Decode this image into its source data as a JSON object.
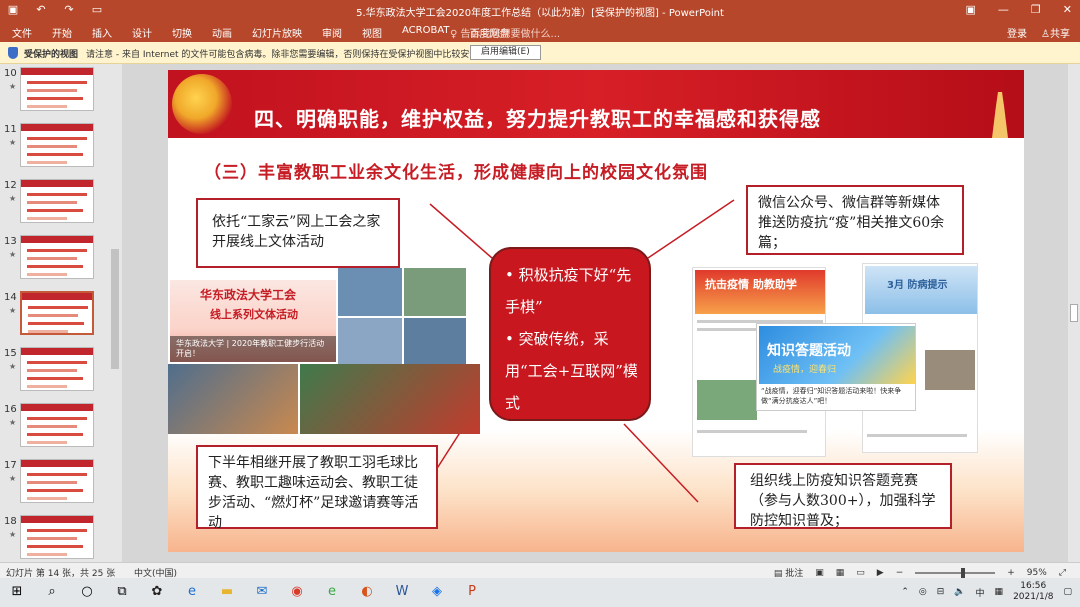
{
  "app": {
    "window_title": "5.华东政法大学工会2020年度工作总结（以此为准）[受保护的视图] - PowerPoint",
    "quick_access": [
      "save-icon",
      "undo-icon",
      "redo-icon",
      "present-icon"
    ]
  },
  "ribbon": {
    "tabs": [
      "文件",
      "开始",
      "插入",
      "设计",
      "切换",
      "动画",
      "幻灯片放映",
      "审阅",
      "视图",
      "ACROBAT",
      "百度网盘"
    ],
    "tell_me": "告诉我您想要做什么...",
    "login": "登录",
    "share": "共享"
  },
  "protected_view": {
    "label": "受保护的视图",
    "message": "请注意 - 来自 Internet 的文件可能包含病毒。除非您需要编辑，否则保持在受保护视图中比较安全。",
    "button": "启用编辑(E)"
  },
  "thumbnails": [
    "10",
    "11",
    "12",
    "13",
    "14",
    "15",
    "16",
    "17",
    "18"
  ],
  "slide": {
    "title": "四、明确职能，维护权益，努力提升教职工的幸福感和获得感",
    "subtitle": "（三）丰富教职工业余文化生活，形成健康向上的校园文化氛围",
    "box1": "依托“工家云”网上工会之家开展线上文体活动",
    "box2": "微信公众号、微信群等新媒体推送防疫抗“疫”相关推文60余篇；",
    "box3": "下半年相继开展了教职工羽毛球比赛、教职工趣味运动会、教职工徒步活动、“燃灯杯”足球邀请赛等活动",
    "box4": "组织线上防疫知识答题竞赛（参与人数300+），加强科学防控知识普及；",
    "center_items": [
      "积极抗疫下好“先手棋”",
      "突破传统，采用“工会+互联网”模式"
    ],
    "poster_title": "华东政法大学工会",
    "poster_subtitle": "线上系列文体活动",
    "poster_caption": "华东政法大学 | 2020年教职工健步行活动开启！",
    "card1_title": "抗击疫情 助教助学",
    "card2_title": "3月 防病提示",
    "quiz_title": "知识答题活动",
    "quiz_slogan": "战疫情，迎春归",
    "quiz_caption": "“战疫情，迎春归”知识答题活动来啦！快来争做“满分抗疫达人”吧！"
  },
  "statusbar": {
    "slide_info": "幻灯片 第 14 张，共 25 张",
    "language": "中文(中国)",
    "notes": "批注",
    "zoom": "95%"
  },
  "taskbar": {
    "ime": "中",
    "time": "16:56",
    "date": "2021/1/8"
  }
}
